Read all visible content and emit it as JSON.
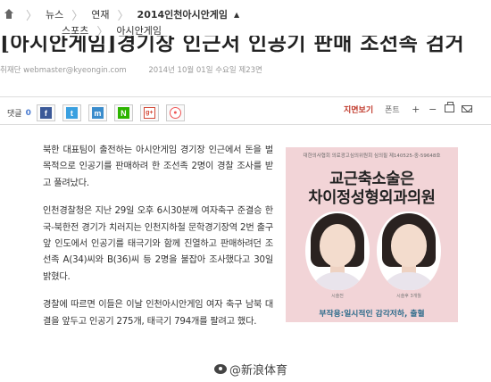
{
  "breadcrumb": {
    "row1": [
      "뉴스",
      "연재",
      "2014인천아시안게임"
    ],
    "up_arrow": "▲",
    "row2": [
      "스포츠",
      "아시안게임"
    ]
  },
  "article": {
    "title": "[아시안게임]경기장 인근서 인공기 판매 조선족 검거",
    "byline_author": "취재단 webmaster@kyeongin.com",
    "byline_date": "2014년 10월 01일 수요일 제23면",
    "paragraphs": [
      "북한 대표팀이 출전하는 아시안게임 경기장 인근에서 돈을 벌 목적으로 인공기를 판매하려 한 조선족 2명이 경찰 조사를 받고 풀려났다.",
      "인천경찰청은 지난 29일 오후 6시30분께 여자축구 준결승 한국-북한전 경기가 치러지는 인천지하철 문학경기장역 2번 출구 앞 인도에서 인공기를 태극기와 함께 진열하고 판매하려던 조선족 A(34)씨와 B(36)씨 등 2명을 불잡아 조사했다고 30일 밝혔다.",
      "경찰에 따르면 이들은 이날 인천아시안게임 여자 축구 남북 대결을 앞두고 인공기 275개, 태극기 794개를 팔려고 했다."
    ]
  },
  "toolbar": {
    "comments_label": "댓글",
    "comments_count": "0",
    "share_icons": [
      {
        "name": "facebook-icon",
        "glyph": "f"
      },
      {
        "name": "twitter-icon",
        "glyph": "t"
      },
      {
        "name": "me2day-icon",
        "glyph": "m"
      },
      {
        "name": "naver-icon",
        "glyph": "N"
      },
      {
        "name": "googleplus-icon",
        "glyph": "g+"
      },
      {
        "name": "kakao-icon",
        "glyph": "●"
      }
    ],
    "subtitle_label": "지면보기",
    "font_label": "폰트",
    "plus": "+",
    "minus": "−"
  },
  "ad": {
    "code": "대한의사협회 의료광고심의위원회 심의필 제140525-중-59648호",
    "headline1": "교근축소술은",
    "headline2": "차이정성형외과의원",
    "name1": "시술전",
    "name2": "시술후 3개월",
    "footer": "부작용:일시적인 감각저하, 출혈"
  },
  "watermark": "@新浪体育"
}
